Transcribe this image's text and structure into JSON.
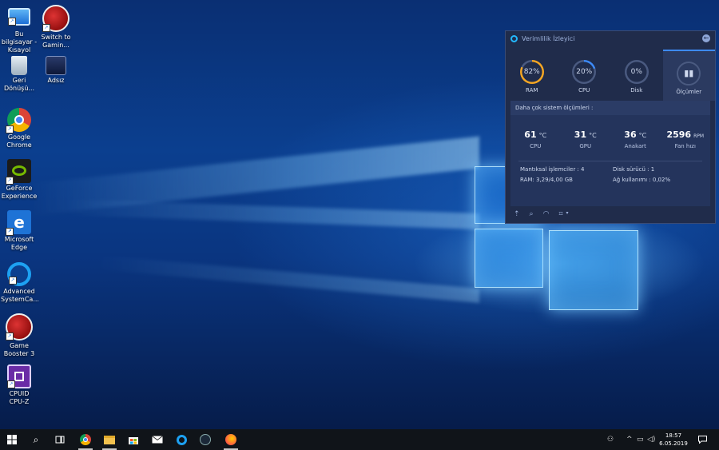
{
  "desktop": {
    "icons": [
      {
        "label": "Bu bilgisayar - Kısayol",
        "icon": "computer-icon"
      },
      {
        "label": "Switch to Gamin...",
        "icon": "game-booster-icon"
      },
      {
        "label": "Geri Dönüşü...",
        "icon": "recycle-bin-icon"
      },
      {
        "label": "Adsız",
        "icon": "image-file-icon"
      },
      {
        "label": "Google Chrome",
        "icon": "chrome-icon"
      },
      {
        "label": "GeForce Experience",
        "icon": "nvidia-icon"
      },
      {
        "label": "Microsoft Edge",
        "icon": "edge-icon"
      },
      {
        "label": "Advanced SystemCa...",
        "icon": "advanced-systemcare-icon"
      },
      {
        "label": "Game Booster 3",
        "icon": "game-booster-icon"
      },
      {
        "label": "CPUID CPU-Z",
        "icon": "cpuz-icon"
      }
    ]
  },
  "widget": {
    "title": "Verimlilik İzleyici",
    "tabs": [
      {
        "value": "82%",
        "label": "RAM",
        "fraction": 0.82,
        "color": "#f5a623"
      },
      {
        "value": "20%",
        "label": "CPU",
        "fraction": 0.2,
        "color": "#3d8af7"
      },
      {
        "value": "0%",
        "label": "Disk",
        "fraction": 0.0,
        "color": "#3d8af7"
      },
      {
        "value": "",
        "label": "Ölçümler",
        "fraction": 0,
        "color": "#3d8af7"
      }
    ],
    "more_label": "Daha çok sistem ölçümleri :",
    "metrics": [
      {
        "value": "61",
        "unit": "°C",
        "name": "CPU"
      },
      {
        "value": "31",
        "unit": "°C",
        "name": "GPU"
      },
      {
        "value": "36",
        "unit": "°C",
        "name": "Anakart"
      },
      {
        "value": "2596",
        "unit": "RPM",
        "name": "Fan hızı"
      }
    ],
    "stats": {
      "logical": "Mantıksal işlemciler : 4",
      "disk": "Disk sürücü : 1",
      "ram": "RAM: 3,29/4,00 GB",
      "network": "Ağ kullanımı : 0,02%"
    }
  },
  "taskbar": {
    "apps": [
      "start-icon",
      "search-icon",
      "task-view-icon",
      "chrome-icon",
      "file-explorer-icon",
      "store-icon",
      "mail-icon",
      "advanced-systemcare-icon",
      "steam-icon",
      "firefox-icon"
    ],
    "clock": {
      "time": "18:57",
      "date": "6.05.2019"
    }
  },
  "colors": {
    "accent": "#3d8af7",
    "ram": "#f5a623",
    "taskbar": "#101419"
  }
}
